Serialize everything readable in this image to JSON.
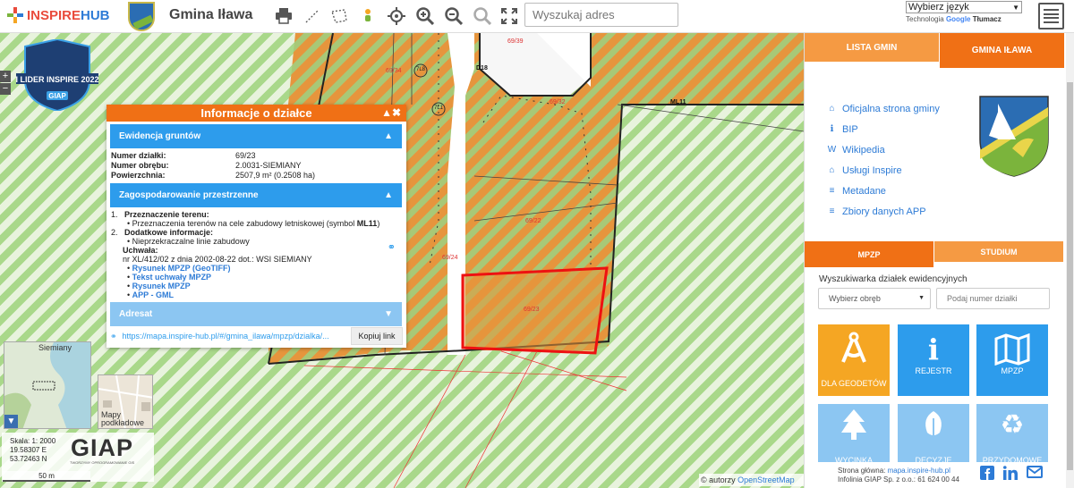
{
  "header": {
    "logo_part1": "INSPIRE",
    "logo_part2": "HUB",
    "title": "Gmina Iława",
    "search_placeholder": "Wyszukaj adres",
    "language_select": "Wybierz język",
    "tech_label": "Technologia",
    "google": "Google",
    "translate_label": "Tłumacz"
  },
  "badge": {
    "line1": "I LIDER INSPIRE 2022",
    "line2": "GIAP"
  },
  "map": {
    "zoom_in": "+",
    "zoom_out": "−",
    "labels": {
      "p6939": "69/39",
      "p6934": "69/34",
      "p6932": "69/32",
      "p6922": "69/22",
      "p6924": "69/24",
      "p6923": "69/23",
      "road_d18": "D18",
      "ml11": "ML11",
      "c718": "7L8",
      "c711": "7L1"
    },
    "minimap_label": "Siemiany",
    "basemaps_label": "Mapy podkładowe",
    "scale_text": "Skala: 1: 2000",
    "coord_e": "19.58307 E",
    "coord_n": "53.72463 N",
    "giap": "GIAP",
    "giap_sub": "TWORZYMY OPROGRAMOWANIE GIS",
    "scalebar": "50 m",
    "attribution_prefix": "© autorzy ",
    "attribution_link": "OpenStreetMap"
  },
  "popup": {
    "title": "Informacje o działce",
    "controls": "▲✖",
    "section1": "Ewidencja gruntów",
    "rows": [
      {
        "k": "Numer działki:",
        "v": "69/23"
      },
      {
        "k": "Numer obrębu:",
        "v": "2.0031-SIEMIANY"
      },
      {
        "k": "Powierzchnia:",
        "v": "2507,9 m² (0.2508 ha)"
      }
    ],
    "section2": "Zagospodarowanie przestrzenne",
    "item1_num": "1.",
    "item1_title": "Przeznaczenie terenu:",
    "item1_bullet": "Przeznaczenia terenów na cele zabudowy letniskowej (symbol ",
    "item1_symbol": "ML11",
    "item1_end": ")",
    "item2_num": "2.",
    "item2_title": "Dodatkowe informacje:",
    "item2_bullet": "Nieprzekraczalne linie zabudowy",
    "uchwala_label": "Uchwała:",
    "uchwala_text": "nr XL/412/02 z dnia 2002-08-22 dot.: WSI SIEMIANY",
    "links": [
      "Rysunek MPZP (GeoTIFF)",
      "Tekst uchwały MPZP",
      "Rysunek MPZP",
      "APP - GML"
    ],
    "section3": "Adresat",
    "url": "https://mapa.inspire-hub.pl/#/gmina_ilawa/mpzp/dzialka/...",
    "copy_button": "Kopiuj link"
  },
  "panel": {
    "tab_lista": "LISTA GMIN",
    "tab_gmina": "GMINA IŁAWA",
    "links": [
      {
        "icon": "home-icon",
        "glyph": "⌂",
        "label": "Oficjalna strona gminy"
      },
      {
        "icon": "info-icon",
        "glyph": "ℹ",
        "label": "BIP"
      },
      {
        "icon": "wikipedia-icon",
        "glyph": "W",
        "label": "Wikipedia"
      },
      {
        "icon": "institution-icon",
        "glyph": "⌂",
        "label": "Usługi Inspire"
      },
      {
        "icon": "database-icon",
        "glyph": "≡",
        "label": "Metadane"
      },
      {
        "icon": "database-icon",
        "glyph": "≡",
        "label": "Zbiory danych APP"
      }
    ],
    "tab_mpzp": "MPZP",
    "tab_studium": "STUDIUM",
    "search_title": "Wyszukiwarka działek ewidencyjnych",
    "select_placeholder": "Wybierz obręb",
    "input_placeholder": "Podaj numer działki",
    "tiles": [
      {
        "name": "tile-dla-geodetow",
        "glyph": "⚖",
        "label": "DLA GEODETÓW",
        "color": "#f5a623"
      },
      {
        "name": "tile-rejestr",
        "glyph": "i",
        "label": "REJESTR",
        "color": "#2d9cec"
      },
      {
        "name": "tile-mpzp",
        "glyph": "▦",
        "label": "MPZP",
        "color": "#2d9cec"
      },
      {
        "name": "tile-wycinka",
        "glyph": "▲",
        "label": "WYCINKA",
        "color": "#8cc6f2"
      },
      {
        "name": "tile-decyzje",
        "glyph": "❦",
        "label": "DECYZJE",
        "color": "#8cc6f2"
      },
      {
        "name": "tile-przydomowe",
        "glyph": "♻",
        "label": "PRZYDOMOWE",
        "color": "#8cc6f2"
      }
    ],
    "footer_l1_prefix": "Strona główna: ",
    "footer_l1_link": "mapa.inspire-hub.pl",
    "footer_l2": "Infolinia GIAP Sp. z o.o.: 61 624 00 44"
  }
}
